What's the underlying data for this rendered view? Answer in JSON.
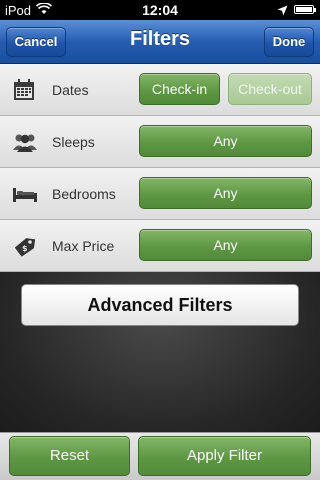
{
  "status_bar": {
    "carrier": "iPod",
    "time": "12:04"
  },
  "navbar": {
    "title": "Filters",
    "cancel_label": "Cancel",
    "done_label": "Done"
  },
  "filters": [
    {
      "label": "Dates",
      "icon": "calendar-icon",
      "options": [
        "Check-in",
        "Check-out"
      ],
      "selected": "Check-in"
    },
    {
      "label": "Sleeps",
      "icon": "people-icon",
      "value": "Any"
    },
    {
      "label": "Bedrooms",
      "icon": "bed-icon",
      "value": "Any"
    },
    {
      "label": "Max Price",
      "icon": "price-tag-icon",
      "value": "Any"
    }
  ],
  "advanced": {
    "label": "Advanced Filters"
  },
  "toolbar": {
    "reset_label": "Reset",
    "apply_label": "Apply Filter"
  },
  "colors": {
    "nav_blue": "#245cb0",
    "button_green": "#5e9843"
  }
}
